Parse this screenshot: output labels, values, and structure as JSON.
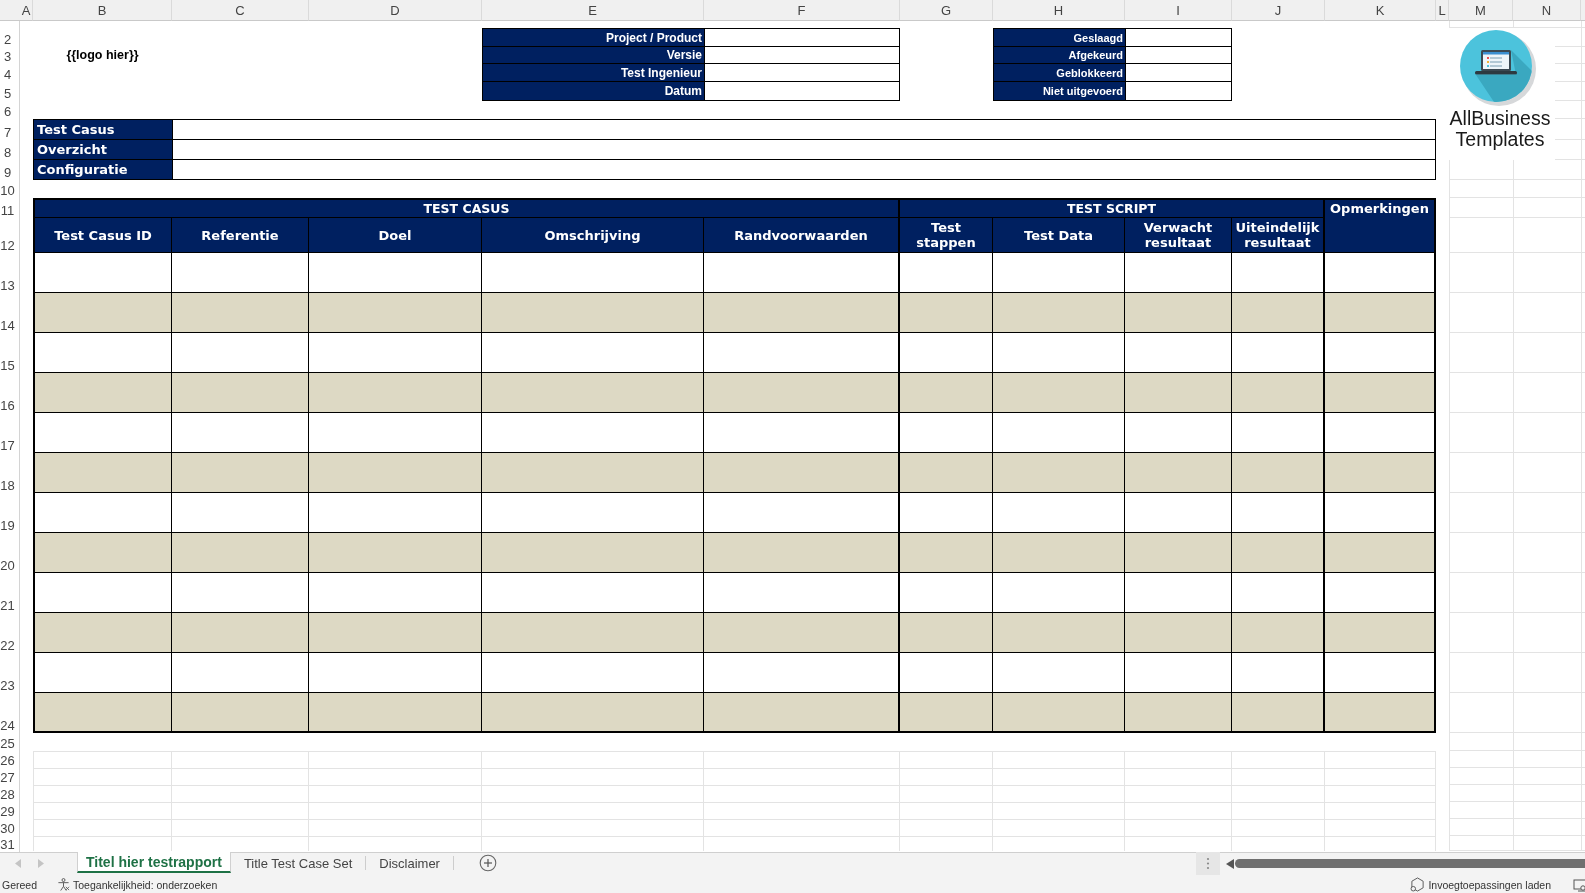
{
  "column_letters": [
    "A",
    "B",
    "C",
    "D",
    "E",
    "F",
    "G",
    "H",
    "I",
    "J",
    "K",
    "L",
    "M",
    "N"
  ],
  "row_numbers": [
    "2",
    "3",
    "4",
    "5",
    "6",
    "7",
    "8",
    "9",
    "10",
    "11",
    "12",
    "13",
    "14",
    "15",
    "16",
    "17",
    "18",
    "19",
    "20",
    "21",
    "22",
    "23",
    "24",
    "25",
    "26",
    "27",
    "28",
    "29",
    "30",
    "31"
  ],
  "logo_placeholder": "{{logo hier}}",
  "project_info": [
    {
      "label": "Project / Product"
    },
    {
      "label": "Versie"
    },
    {
      "label": "Test Ingenieur"
    },
    {
      "label": "Datum"
    }
  ],
  "result_counts": [
    {
      "label": "Geslaagd"
    },
    {
      "label": "Afgekeurd"
    },
    {
      "label": "Geblokkeerd"
    },
    {
      "label": "Niet uitgevoerd"
    }
  ],
  "logo": {
    "text": "AllBusiness Templates"
  },
  "test_info": [
    {
      "label": "Test Casus"
    },
    {
      "label": "Overzicht"
    },
    {
      "label": "Configuratie"
    }
  ],
  "table": {
    "groups": [
      {
        "label": "TEST CASUS",
        "columns": [
          "Test Casus ID",
          "Referentie",
          "Doel",
          "Omschrijving",
          "Randvoorwaarden"
        ]
      },
      {
        "label": "TEST SCRIPT",
        "columns": [
          "Test stappen",
          "Test Data",
          "Verwacht resultaat",
          "Uiteindelijk resultaat"
        ]
      },
      {
        "label": "Opmerkingen"
      }
    ],
    "rows": [
      {
        "shaded": false
      },
      {
        "shaded": true
      },
      {
        "shaded": false
      },
      {
        "shaded": true
      },
      {
        "shaded": false
      },
      {
        "shaded": true
      },
      {
        "shaded": false
      },
      {
        "shaded": true
      },
      {
        "shaded": false
      },
      {
        "shaded": true
      },
      {
        "shaded": false
      },
      {
        "shaded": true
      }
    ]
  },
  "sheet_tabs": [
    {
      "label": "Titel hier testrapport",
      "selected": true
    },
    {
      "label": "Title Test Case Set",
      "selected": false
    },
    {
      "label": "Disclaimer",
      "selected": false
    }
  ],
  "status_bar": {
    "mode": "Gereed",
    "accessibility": "Toegankelijkheid: onderzoeken",
    "addins": "Invoegtoepassingen laden"
  }
}
